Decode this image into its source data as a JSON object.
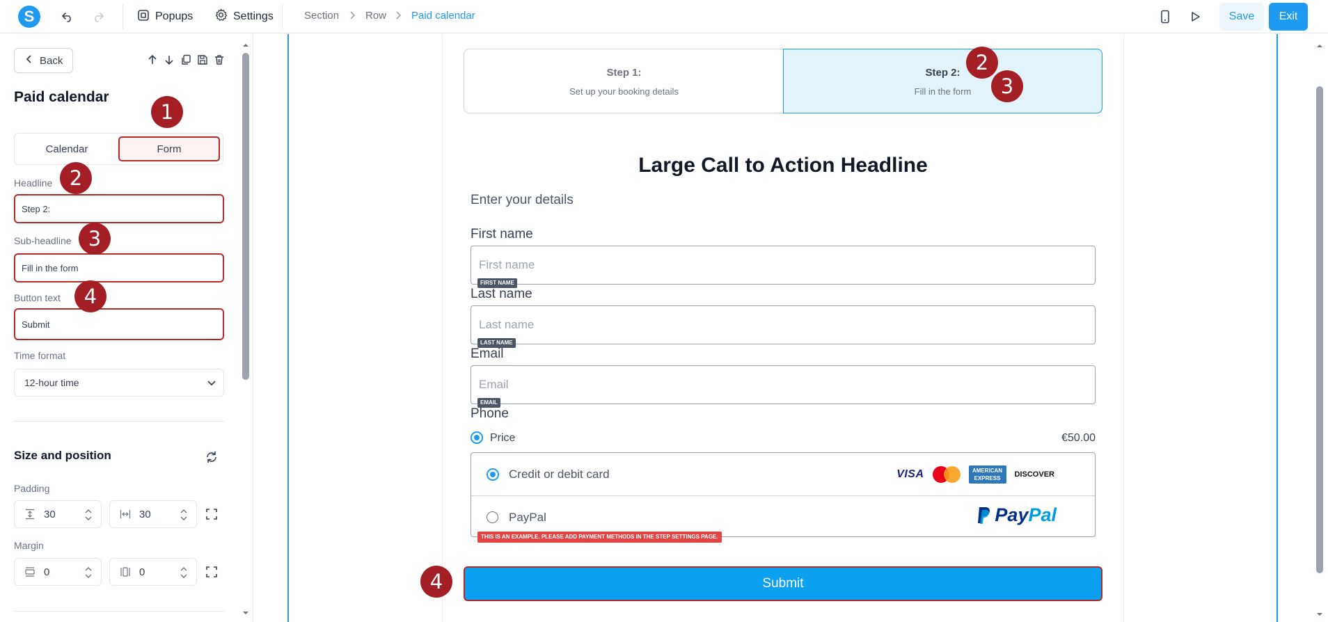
{
  "topbar": {
    "logo_letter": "S",
    "popups_label": "Popups",
    "settings_label": "Settings",
    "breadcrumb": [
      "Section",
      "Row",
      "Paid calendar"
    ],
    "save_label": "Save",
    "exit_label": "Exit"
  },
  "panel": {
    "back_label": "Back",
    "title": "Paid calendar",
    "tabs": [
      {
        "label": "Calendar",
        "active": false
      },
      {
        "label": "Form",
        "active": true
      }
    ],
    "headline_label": "Headline",
    "headline_value": "Step 2:",
    "subheadline_label": "Sub-headline",
    "subheadline_value": "Fill in the form",
    "button_text_label": "Button text",
    "button_text_value": "Submit",
    "time_format_label": "Time format",
    "time_format_value": "12-hour time",
    "size_position_title": "Size and position",
    "padding_label": "Padding",
    "padding_vertical": "30",
    "padding_horizontal": "30",
    "margin_label": "Margin",
    "margin_vertical": "0",
    "margin_horizontal": "0"
  },
  "canvas": {
    "steps": [
      {
        "title": "Step 1:",
        "subtitle": "Set up your booking details",
        "active": false
      },
      {
        "title": "Step 2:",
        "subtitle": "Fill in the form",
        "active": true
      }
    ],
    "headline": "Large Call to Action Headline",
    "intro": "Enter your details",
    "fields": [
      {
        "label": "First name",
        "placeholder": "First name",
        "tag": "FIRST NAME"
      },
      {
        "label": "Last name",
        "placeholder": "Last name",
        "tag": "LAST NAME"
      },
      {
        "label": "Email",
        "placeholder": "Email",
        "tag": "EMAIL"
      }
    ],
    "phone_label": "Phone",
    "price_label": "Price",
    "price_value": "€50.00",
    "payment_methods": [
      {
        "label": "Credit or debit card",
        "selected": true
      },
      {
        "label": "PayPal",
        "selected": false
      }
    ],
    "card_brands": {
      "visa": "VISA",
      "amex_line1": "AMERICAN",
      "amex_line2": "EXPRESS",
      "discover": "DISCOVER"
    },
    "paypal_logo": {
      "part1": "Pay",
      "part2": "Pal"
    },
    "payment_warning": "THIS IS AN EXAMPLE. PLEASE ADD PAYMENT METHODS IN THE STEP SETTINGS PAGE.",
    "submit_label": "Submit"
  },
  "annotations": [
    "1",
    "2",
    "3",
    "4",
    "2",
    "3",
    "4"
  ],
  "colors": {
    "accent": "#1e9bf0",
    "annotation": "#a31f24",
    "active_step_bg": "#e3f3fc"
  }
}
